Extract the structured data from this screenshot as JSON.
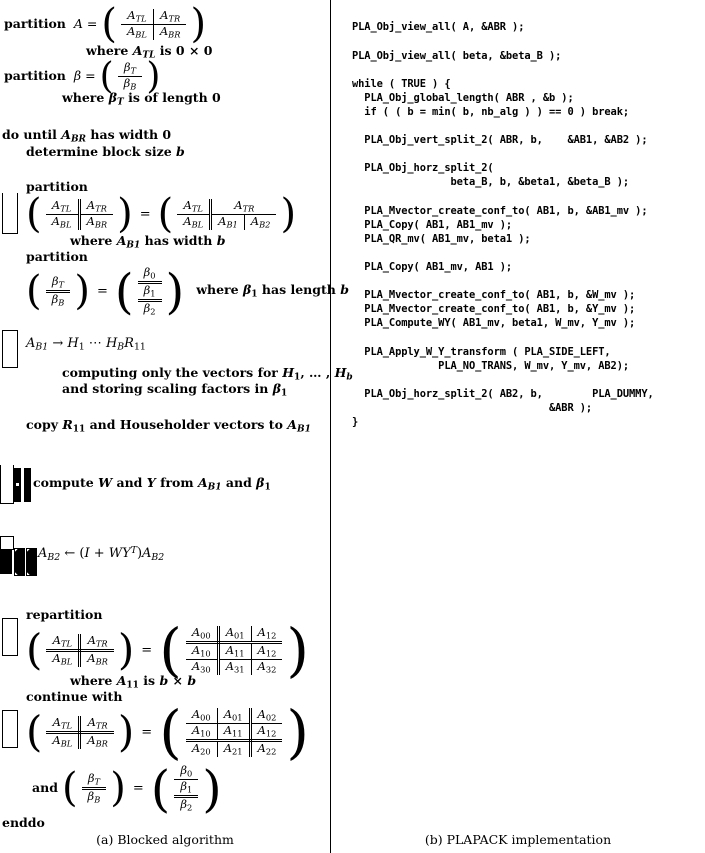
{
  "figure": {
    "caption_a": "(a) Blocked algorithm",
    "caption_b": "(b) PLAPACK implementation"
  },
  "algorithm": {
    "partition_a_label": "partition",
    "partition_a_var": "A =",
    "partition_a_matrix": [
      [
        "A_TL",
        "A_TR"
      ],
      [
        "A_BL",
        "A_BR"
      ]
    ],
    "where_a": "where A_TL is 0 × 0",
    "partition_b_label": "partition",
    "partition_b_var": "β =",
    "partition_b_matrix": [
      [
        "β_T"
      ],
      [
        "β_B"
      ]
    ],
    "where_b": "where β_T is of length 0",
    "do_until": "do until A_BR has width 0",
    "determine": "determine block size b",
    "partition1_label": "partition",
    "partition1_lhs": [
      [
        "A_TL",
        "A_TR"
      ],
      [
        "A_BL",
        "A_BR"
      ]
    ],
    "partition1_rhs": [
      [
        "A_TL",
        "A_TR",
        ""
      ],
      [
        "A_BL",
        "A_B1",
        "A_B2"
      ]
    ],
    "where_ab1": "where A_B1 has width b",
    "partition2_label": "partition",
    "partition2_lhs": [
      [
        "β_T"
      ],
      [
        "β_B"
      ]
    ],
    "partition2_rhs": [
      [
        "β_0"
      ],
      [
        "β_1"
      ],
      [
        "β_2"
      ]
    ],
    "where_beta1": "where β_1 has length b",
    "qr_line": "A_B1 → H_1 ··· H_B R_11",
    "computing_line1": "computing only the vectors for H_1, … , H_b",
    "computing_line2": "and storing scaling factors in β_1",
    "copy_line": "copy R_11 and Householder vectors to A_B1",
    "compute_wy": "compute W and Y from A_B1 and β_1",
    "apply_wy": "A_B2 ← (I + W Y^T) A_B2",
    "repartition_label": "repartition",
    "repartition_lhs": [
      [
        "A_TL",
        "A_TR"
      ],
      [
        "A_BL",
        "A_BR"
      ]
    ],
    "repartition_rhs": [
      [
        "A_00",
        "A_01",
        "A_12"
      ],
      [
        "A_10",
        "A_11",
        "A_12"
      ],
      [
        "A_30",
        "A_31",
        "A_32"
      ]
    ],
    "where_a11": "where A_11 is b × b",
    "continue_label": "continue with",
    "continue_lhs": [
      [
        "A_TL",
        "A_TR"
      ],
      [
        "A_BL",
        "A_BR"
      ]
    ],
    "continue_rhs": [
      [
        "A_00",
        "A_01",
        "A_02"
      ],
      [
        "A_10",
        "A_11",
        "A_12"
      ],
      [
        "A_20",
        "A_21",
        "A_22"
      ]
    ],
    "and_label": "and",
    "and_lhs": [
      [
        "β_T"
      ],
      [
        "β_B"
      ]
    ],
    "and_rhs": [
      [
        "β_0"
      ],
      [
        "β_1"
      ],
      [
        "β_2"
      ]
    ],
    "enddo": "enddo"
  },
  "code": {
    "text": "PLA_Obj_view_all( A, &ABR );\n\nPLA_Obj_view_all( beta, &beta_B );\n\nwhile ( TRUE ) {\n  PLA_Obj_global_length( ABR , &b );\n  if ( ( b = min( b, nb_alg ) ) == 0 ) break;\n\n  PLA_Obj_vert_split_2( ABR, b,    &AB1, &AB2 );\n\n  PLA_Obj_horz_split_2(\n                beta_B, b, &beta1, &beta_B );\n\n  PLA_Mvector_create_conf_to( AB1, b, &AB1_mv );\n  PLA_Copy( AB1, AB1_mv );\n  PLA_QR_mv( AB1_mv, beta1 );\n\n  PLA_Copy( AB1_mv, AB1 );\n\n  PLA_Mvector_create_conf_to( AB1, b, &W_mv );\n  PLA_Mvector_create_conf_to( AB1, b, &Y_mv );\n  PLA_Compute_WY( AB1_mv, beta1, W_mv, Y_mv );\n\n  PLA_Apply_W_Y_transform ( PLA_SIDE_LEFT,\n              PLA_NO_TRANS, W_mv, Y_mv, AB2);\n\n  PLA_Obj_horz_split_2( AB2, b,        PLA_DUMMY,\n                                &ABR );\n}"
  }
}
